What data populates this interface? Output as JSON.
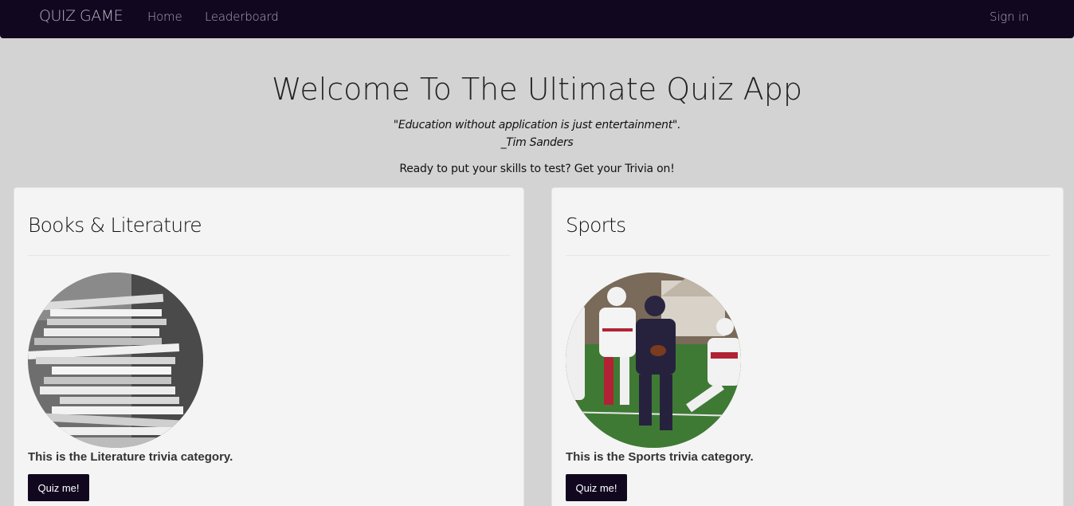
{
  "nav": {
    "brand": "QUIZ GAME",
    "home": "Home",
    "leaderboard": "Leaderboard",
    "signin": "Sign in"
  },
  "hero": {
    "title": "Welcome To The Ultimate Quiz App",
    "quote": "\"Education without application is just entertainment\".",
    "author": "_Tim Sanders",
    "tagline": "Ready to put your skills to test? Get your Trivia on!"
  },
  "categories": [
    {
      "title": "Books & Literature",
      "image": "stack-of-books-photo",
      "description": "This is the Literature trivia category.",
      "button": "Quiz me!"
    },
    {
      "title": "Sports",
      "image": "football-players-photo",
      "description": "This is the Sports trivia category.",
      "button": "Quiz me!"
    }
  ],
  "colors": {
    "navbar": "#110820",
    "background": "#d3d3d3",
    "card": "#f4f4f4",
    "button": "#110820"
  }
}
